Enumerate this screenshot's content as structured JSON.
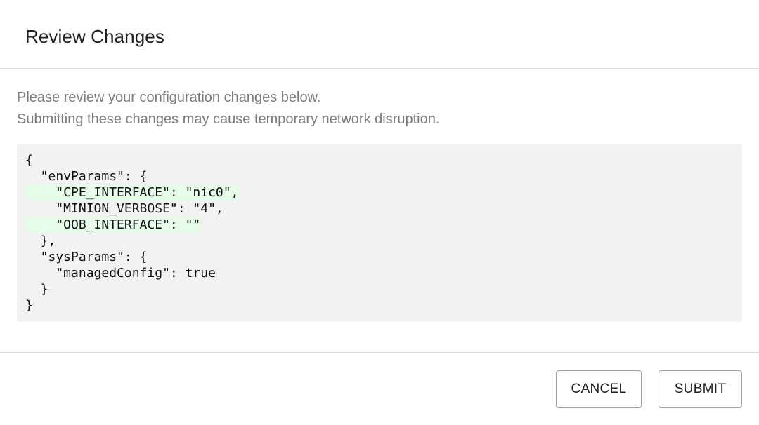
{
  "dialog": {
    "title": "Review Changes",
    "description": [
      "Please review your configuration changes below.",
      "Submitting these changes may cause temporary network disruption."
    ],
    "code": [
      {
        "text": "{",
        "added": false
      },
      {
        "text": "  \"envParams\": {",
        "added": false
      },
      {
        "text": "    \"CPE_INTERFACE\": \"nic0\",",
        "added": true
      },
      {
        "text": "    \"MINION_VERBOSE\": \"4\",",
        "added": false
      },
      {
        "text": "    \"OOB_INTERFACE\": \"\"",
        "added": true
      },
      {
        "text": "  },",
        "added": false
      },
      {
        "text": "  \"sysParams\": {",
        "added": false
      },
      {
        "text": "    \"managedConfig\": true",
        "added": false
      },
      {
        "text": "  }",
        "added": false
      },
      {
        "text": "}",
        "added": false
      }
    ],
    "buttons": {
      "cancel": "CANCEL",
      "submit": "SUBMIT"
    }
  },
  "colors": {
    "added_highlight": "#e6fbe9",
    "code_background": "#f2f2f2"
  }
}
